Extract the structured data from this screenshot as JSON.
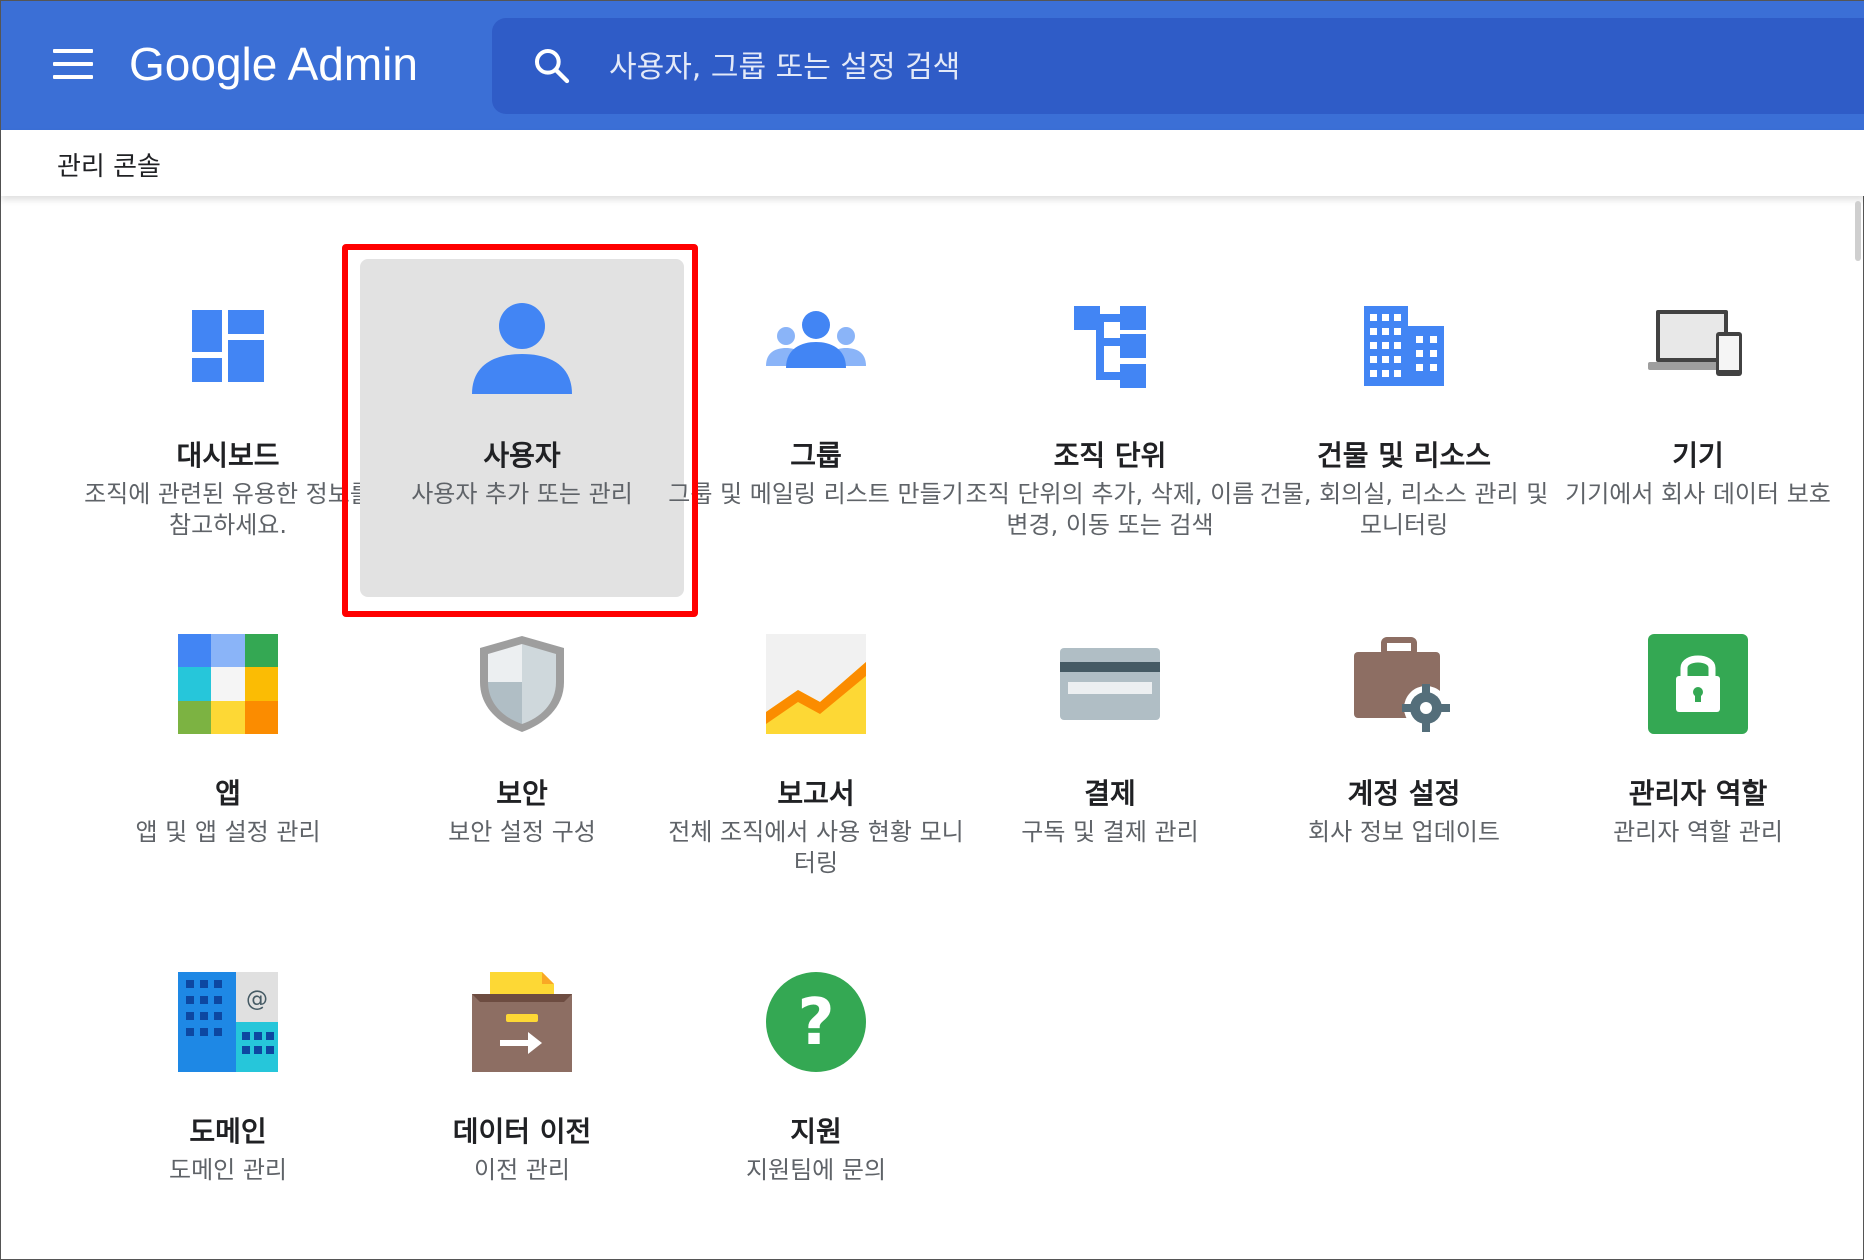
{
  "header": {
    "app_name": "Google Admin",
    "search_placeholder": "사용자, 그룹 또는 설정 검색"
  },
  "breadcrumb": "관리 콘솔",
  "tiles": [
    {
      "title": "대시보드",
      "desc": "조직에 관련된 유용한 정보를 참고하세요.",
      "icon": "dashboard-icon"
    },
    {
      "title": "사용자",
      "desc": "사용자 추가 또는 관리",
      "icon": "user-icon",
      "selected": true
    },
    {
      "title": "그룹",
      "desc": "그룹 및 메일링 리스트 만들기",
      "icon": "group-icon"
    },
    {
      "title": "조직 단위",
      "desc": "조직 단위의 추가, 삭제, 이름 변경, 이동 또는 검색",
      "icon": "org-unit-icon"
    },
    {
      "title": "건물 및 리소스",
      "desc": "건물, 회의실, 리소스 관리 및 모니터링",
      "icon": "building-icon"
    },
    {
      "title": "기기",
      "desc": "기기에서 회사 데이터 보호",
      "icon": "devices-icon"
    },
    {
      "title": "앱",
      "desc": "앱 및 앱 설정 관리",
      "icon": "apps-icon"
    },
    {
      "title": "보안",
      "desc": "보안 설정 구성",
      "icon": "security-shield-icon"
    },
    {
      "title": "보고서",
      "desc": "전체 조직에서 사용 현황 모니터링",
      "icon": "reports-chart-icon"
    },
    {
      "title": "결제",
      "desc": "구독 및 결제 관리",
      "icon": "billing-card-icon"
    },
    {
      "title": "계정 설정",
      "desc": "회사 정보 업데이트",
      "icon": "account-settings-icon"
    },
    {
      "title": "관리자 역할",
      "desc": "관리자 역할 관리",
      "icon": "admin-roles-lock-icon"
    },
    {
      "title": "도메인",
      "desc": "도메인 관리",
      "icon": "domains-icon"
    },
    {
      "title": "데이터 이전",
      "desc": "이전 관리",
      "icon": "data-migration-icon"
    },
    {
      "title": "지원",
      "desc": "지원팀에 문의",
      "icon": "support-help-icon"
    }
  ],
  "colors": {
    "header_bg": "#3b6fd6",
    "search_bg": "#2f5cc7",
    "icon_blue": "#4285f4",
    "highlight_border": "#ff0000"
  }
}
